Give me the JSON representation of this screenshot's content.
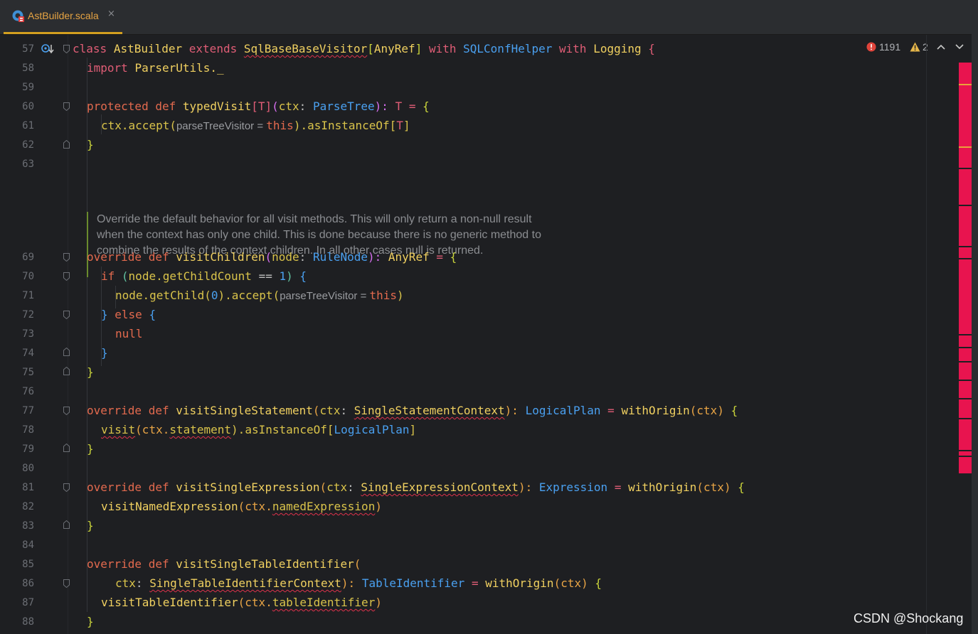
{
  "tab": {
    "file_name": "AstBuilder.scala",
    "file_icon": "scala-class-icon",
    "close": "×"
  },
  "status": {
    "errors_icon": "error-icon",
    "errors_count": "1191",
    "warnings_icon": "warning-icon",
    "warnings_count": "2"
  },
  "gutter": {
    "lines": [
      "57",
      "58",
      "59",
      "60",
      "61",
      "62",
      "63",
      "69",
      "70",
      "71",
      "72",
      "73",
      "74",
      "75",
      "76",
      "77",
      "78",
      "79",
      "80",
      "81",
      "82",
      "83",
      "84",
      "85",
      "86",
      "87",
      "88"
    ]
  },
  "code": {
    "l57": {
      "class": "class",
      "name": "AstBuilder",
      "extends": "extends",
      "base": "SqlBaseBaseVisitor",
      "lb": "[",
      "anyref": "AnyRef",
      "rb": "]",
      "with1": "with",
      "helper": "SQLConfHelper",
      "with2": "with",
      "logging": "Logging",
      "brace": "{"
    },
    "l58": {
      "import": "import",
      "pkg": "ParserUtils._"
    },
    "l60": {
      "protected": "protected",
      "def": "def",
      "name": "typedVisit",
      "tparam": "[T]",
      "open": "(",
      "ctx": "ctx",
      "colon": ":",
      "type": "ParseTree",
      "close": "):",
      "T": "T",
      "eq": "=",
      "brace": "{"
    },
    "l61": {
      "ctx": "ctx",
      "accept": ".accept(",
      "hint": "parseTreeVisitor = ",
      "this": "this",
      "tail": ").asInstanceOf[",
      "T": "T",
      "end": "]"
    },
    "l62": {
      "brace": "}"
    },
    "doc": "Override the default behavior for all visit methods. This will only return a non-null result when the context has only one child. This is done because there is no generic method to combine the results of the context children. In all other cases null is returned.",
    "l69": {
      "override": "override",
      "def": "def",
      "name": "visitChildren",
      "open": "(",
      "node": "node",
      "colon": ":",
      "type": "RuleNode",
      "close": "):",
      "ret": "AnyRef",
      "eq": "=",
      "brace": "{"
    },
    "l70": {
      "if": "if",
      "open": "(",
      "node": "node",
      "call": ".getChildCount",
      "op": "==",
      "num": "1",
      "close": ")",
      "brace": "{"
    },
    "l71": {
      "node": "node",
      "call": ".getChild(",
      "num": "0",
      "accept": ").accept(",
      "hint": "parseTreeVisitor = ",
      "this": "this",
      "end": ")"
    },
    "l72": {
      "brace1": "}",
      "else": "else",
      "brace2": "{"
    },
    "l73": {
      "null": "null"
    },
    "l74": {
      "brace": "}"
    },
    "l75": {
      "brace": "}"
    },
    "l77": {
      "override": "override",
      "def": "def",
      "name": "visitSingleStatement",
      "open": "(",
      "ctx": "ctx",
      "colon": ":",
      "type": "SingleStatementContext",
      "close": "):",
      "ret": "LogicalPlan",
      "eq": "=",
      "origin": "withOrigin",
      "arg": "(ctx)",
      "brace": "{"
    },
    "l78": {
      "visit": "visit",
      "arg1": "(ctx.",
      "stmt": "statement",
      "tail": ").asInstanceOf[",
      "type": "LogicalPlan",
      "end": "]"
    },
    "l79": {
      "brace": "}"
    },
    "l81": {
      "override": "override",
      "def": "def",
      "name": "visitSingleExpression",
      "open": "(",
      "ctx": "ctx",
      "colon": ":",
      "type": "SingleExpressionContext",
      "close": "):",
      "ret": "Expression",
      "eq": "=",
      "origin": "withOrigin",
      "arg": "(ctx)",
      "brace": "{"
    },
    "l82": {
      "call": "visitNamedExpression",
      "arg1": "(ctx.",
      "field": "namedExpression",
      "end": ")"
    },
    "l83": {
      "brace": "}"
    },
    "l85": {
      "override": "override",
      "def": "def",
      "name": "visitSingleTableIdentifier",
      "open": "("
    },
    "l86": {
      "ctx": "ctx",
      "colon": ":",
      "type": "SingleTableIdentifierContext",
      "close": "):",
      "ret": "TableIdentifier",
      "eq": "=",
      "origin": "withOrigin",
      "arg": "(ctx)",
      "brace": "{"
    },
    "l87": {
      "call": "visitTableIdentifier",
      "arg1": "(ctx.",
      "field": "tableIdentifier",
      "end": ")"
    },
    "l88": {
      "brace": "}"
    }
  },
  "watermark": "CSDN @Shockang"
}
